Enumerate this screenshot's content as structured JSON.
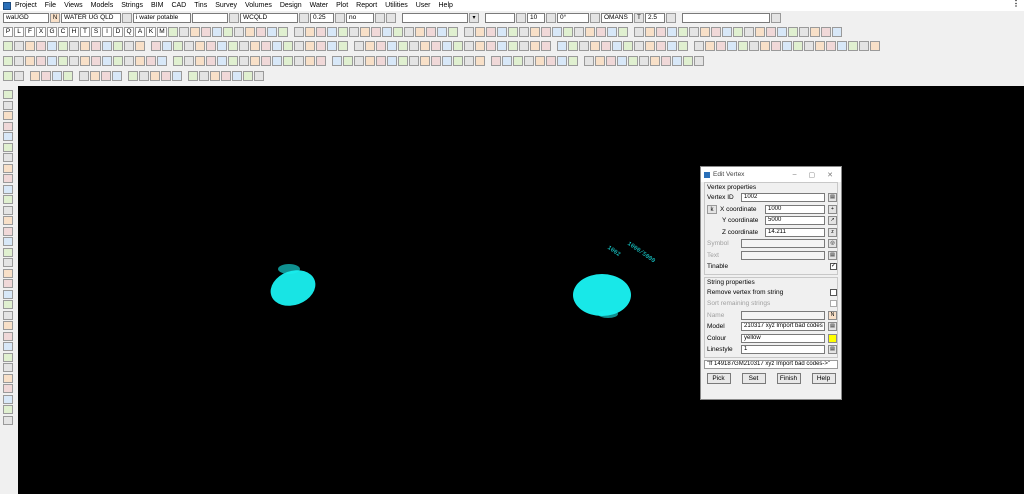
{
  "menu": [
    "Project",
    "File",
    "Views",
    "Models",
    "Strings",
    "BIM",
    "CAD",
    "Tins",
    "Survey",
    "Volumes",
    "Design",
    "Water",
    "Plot",
    "Report",
    "Utilities",
    "User",
    "Help"
  ],
  "toolbar1": {
    "model_code": "waUGD",
    "model_name": "WATER UG QLD",
    "layer_value": "i water potable",
    "empty_field": "",
    "style_value": "WCQLD",
    "weight_value": "0.25",
    "no_value": "no",
    "z_value": "10",
    "angle_value": "0°",
    "font_value": "OMANS",
    "size_value": "2.5"
  },
  "letter_buttons": [
    "P",
    "L",
    "F",
    "X",
    "G",
    "C",
    "H",
    "T",
    "S",
    "I",
    "D",
    "Q",
    "A",
    "K",
    "M"
  ],
  "canvas": {
    "labels": [
      "1002",
      "1000/5000"
    ]
  },
  "dialog": {
    "title": "Edit Vertex",
    "vertex_group": "Vertex properties",
    "vertex_id_label": "Vertex ID",
    "vertex_id_value": "1002",
    "x_label": "X coordinate",
    "x_value": "1000",
    "y_label": "Y coordinate",
    "y_value": "5000",
    "z_label": "Z coordinate",
    "z_value": "14.211",
    "symbol_label": "Symbol",
    "text_label": "Text",
    "tinable_label": "Tinable",
    "string_group": "String properties",
    "remove_label": "Remove vertex from string",
    "sort_label": "Sort remaining strings",
    "name_label": "Name",
    "model_label": "Model",
    "model_value": "210317 xyz Import bad codes",
    "colour_label": "Colour",
    "colour_value": "yellow",
    "linestyle_label": "Linestyle",
    "linestyle_value": "1",
    "status_text": "\"ff 149187GM210317 xyz Import bad codes->\"",
    "buttons": {
      "pick": "Pick",
      "set": "Set",
      "finish": "Finish",
      "help": "Help"
    }
  },
  "colors": {
    "canvas": "#000000",
    "points": "#19f0f0",
    "colour_swatch": "#ffff00"
  }
}
